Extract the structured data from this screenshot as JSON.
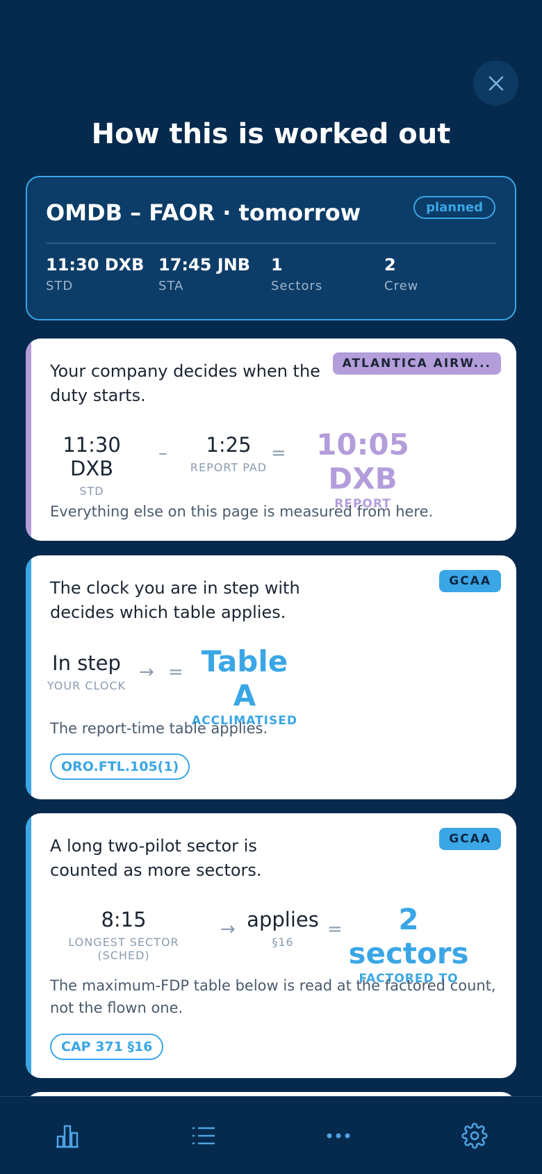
{
  "header": {
    "title": "How this is worked out",
    "close_icon": "close-icon"
  },
  "flight": {
    "route": "OMDB – FAOR · tomorrow",
    "status": "planned",
    "meta": [
      {
        "value": "11:30 DXB",
        "label": "STD"
      },
      {
        "value": "17:45 JNB",
        "label": "STA"
      },
      {
        "value": "1",
        "label": "Sectors"
      },
      {
        "value": "2",
        "label": "Crew"
      }
    ]
  },
  "cards": [
    {
      "heading": "Your company decides when the duty starts.",
      "tag": "ATLANTICA AIRW...",
      "accent": "#b39ddb",
      "eq": {
        "a_value": "11:30 DXB",
        "a_label": "STD",
        "op1": "–",
        "b_value": "1:25",
        "b_label": "REPORT PAD",
        "op2": "=",
        "result_value": "10:05 DXB",
        "result_label": "REPORT"
      },
      "note": "Everything else on this page is measured from here."
    },
    {
      "heading": "The clock you are in step with decides which table applies.",
      "tag": "GCAA",
      "accent": "#3aa6e6",
      "eq": {
        "a_value": "In step",
        "a_label": "YOUR CLOCK",
        "op1": "→",
        "op2": "=",
        "result_value": "Table A",
        "result_label": "ACCLIMATISED"
      },
      "note": "The report-time table applies.",
      "ref": "ORO.FTL.105(1)"
    },
    {
      "heading": "A long two-pilot sector is counted as more sectors.",
      "tag": "GCAA",
      "accent": "#3aa6e6",
      "eq": {
        "a_value": "8:15",
        "a_label": "LONGEST SECTOR (SCHED)",
        "op1": "→",
        "b_value": "applies",
        "b_label": "§16",
        "op2": "=",
        "result_value": "2 sectors",
        "result_label": "FACTORED TO"
      },
      "note": "The maximum-FDP table below is read at the factored count, not the flown one.",
      "ref": "CAP 371 §16"
    }
  ],
  "tabbar": {
    "items": [
      "bar-chart-icon",
      "list-icon",
      "more-icon",
      "gear-icon"
    ]
  }
}
